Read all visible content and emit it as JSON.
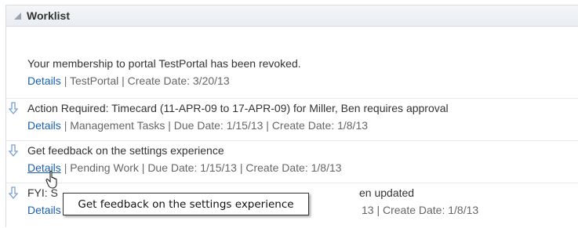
{
  "worklist": {
    "title": "Worklist",
    "items": [
      {
        "title": "Your membership to portal TestPortal has been revoked.",
        "details_label": "Details",
        "meta": "TestPortal | Create Date: 3/20/13"
      },
      {
        "title": "Action Required: Timecard (11-APR-09 to 17-APR-09) for Miller, Ben requires approval",
        "details_label": "Details",
        "meta": "Management Tasks | Due Date: 1/15/13 | Create Date: 1/8/13"
      },
      {
        "title": "Get feedback on the settings experience",
        "details_label": "Details",
        "meta": "Pending Work | Due Date: 1/15/13 | Create Date: 1/8/13"
      },
      {
        "title_left": "FYI: S",
        "title_right": "en updated",
        "details_label": "Details",
        "meta_partial": "13 | Create Date: 1/8/13"
      }
    ]
  },
  "tooltip": {
    "text": "Get feedback on the settings experience"
  },
  "separator": "|",
  "colors": {
    "link": "#1a5fb4",
    "header_bg": "#eceff2",
    "arrow": "#7a9fd0"
  },
  "icons": {
    "collapse": "collapse-triangle-icon",
    "item_arrow": "down-arrow-icon",
    "cursor": "hand-pointer-cursor-icon"
  }
}
